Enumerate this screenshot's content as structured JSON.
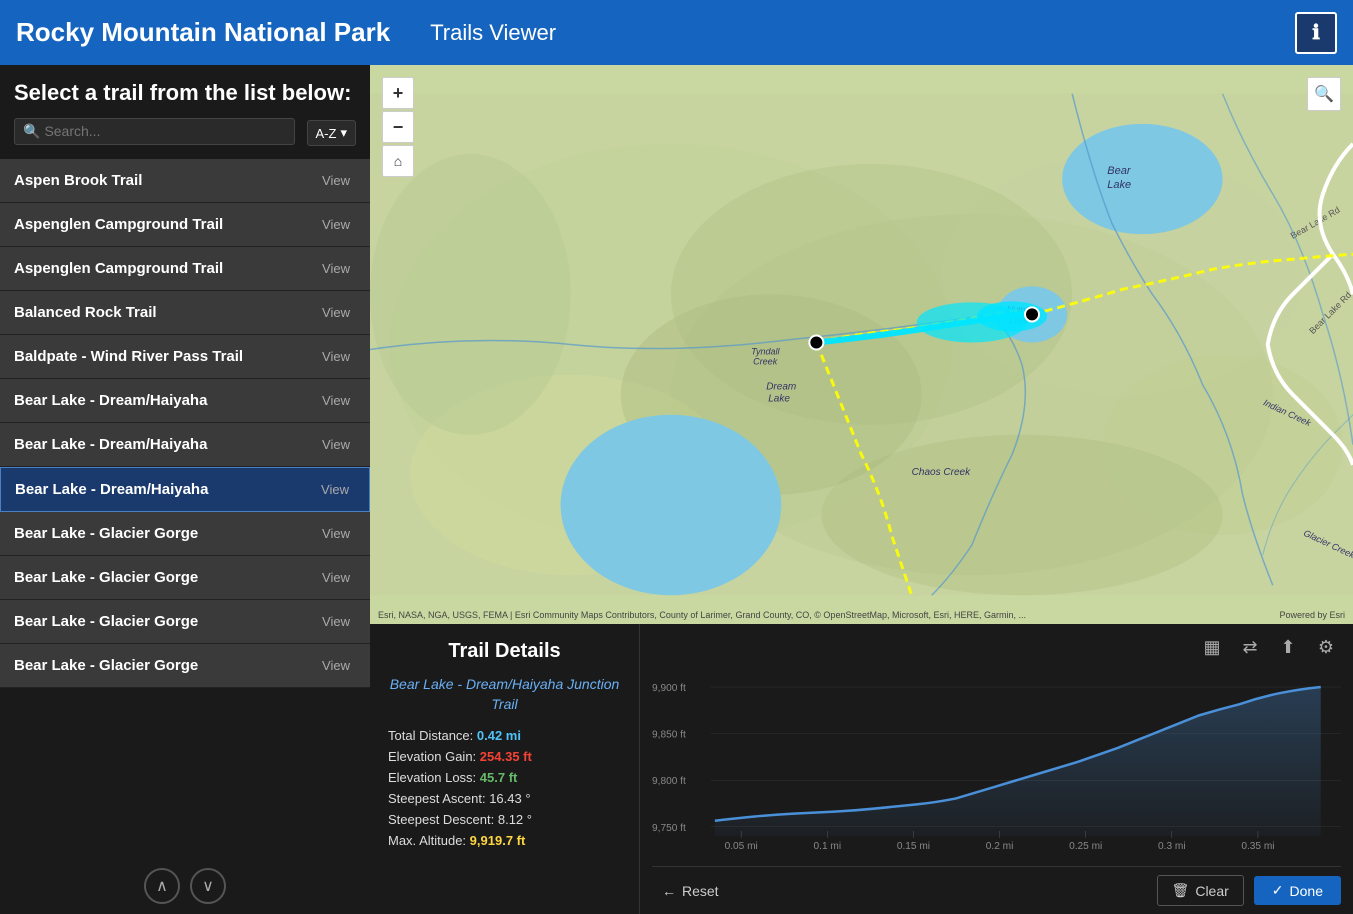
{
  "header": {
    "title": "Rocky Mountain National Park",
    "subtitle": "Trails Viewer",
    "info_label": "ℹ"
  },
  "sidebar": {
    "select_label": "Select a trail from the list below:",
    "search_placeholder": "Search...",
    "sort_label": "A-Z",
    "trails": [
      {
        "name": "Aspen Brook Trail",
        "view_label": "View",
        "selected": false
      },
      {
        "name": "Aspenglen Campground Trail",
        "view_label": "View",
        "selected": false
      },
      {
        "name": "Aspenglen Campground Trail",
        "view_label": "View",
        "selected": false
      },
      {
        "name": "Balanced Rock Trail",
        "view_label": "View",
        "selected": false
      },
      {
        "name": "Baldpate - Wind River Pass Trail",
        "view_label": "View",
        "selected": false
      },
      {
        "name": "Bear Lake - Dream/Haiyaha",
        "view_label": "View",
        "selected": false
      },
      {
        "name": "Bear Lake - Dream/Haiyaha",
        "view_label": "View",
        "selected": false
      },
      {
        "name": "Bear Lake - Dream/Haiyaha",
        "view_label": "View",
        "selected": true
      },
      {
        "name": "Bear Lake - Glacier Gorge",
        "view_label": "View",
        "selected": false
      },
      {
        "name": "Bear Lake - Glacier Gorge",
        "view_label": "View",
        "selected": false
      },
      {
        "name": "Bear Lake - Glacier Gorge",
        "view_label": "View",
        "selected": false
      },
      {
        "name": "Bear Lake - Glacier Gorge",
        "view_label": "View",
        "selected": false
      }
    ],
    "nav_up": "⌃",
    "nav_down": "⌄"
  },
  "map": {
    "attribution": "Esri, NASA, NGA, USGS, FEMA | Esri Community Maps Contributors, County of Larimer, Grand County, CO, © OpenStreetMap, Microsoft, Esri, HERE, Garmin, ...",
    "powered_by": "Powered by Esri",
    "zoom_in": "+",
    "zoom_out": "−",
    "home": "⌂",
    "search": "🔍"
  },
  "trail_details": {
    "title": "Trail Details",
    "trail_name": "Bear Lake - Dream/Haiyaha Junction Trail",
    "stats": {
      "total_distance_label": "Total Distance:",
      "total_distance_val": "0.42 mi",
      "elevation_gain_label": "Elevation Gain:",
      "elevation_gain_val": "254.35 ft",
      "elevation_loss_label": "Elevation Loss:",
      "elevation_loss_val": "45.7 ft",
      "steepest_ascent_label": "Steepest Ascent:",
      "steepest_ascent_val": "16.43 °",
      "steepest_descent_label": "Steepest Descent:",
      "steepest_descent_val": "8.12 °",
      "max_altitude_label": "Max. Altitude:",
      "max_altitude_val": "9,919.7 ft"
    }
  },
  "chart": {
    "y_labels": [
      "9,900 ft",
      "9,850 ft",
      "9,800 ft",
      "9,750 ft"
    ],
    "x_labels": [
      "0.05 mi",
      "0.1 mi",
      "0.15 mi",
      "0.2 mi",
      "0.25 mi",
      "0.3 mi",
      "0.35 mi"
    ],
    "buttons": {
      "bar_chart": "▦",
      "swap": "⇄",
      "share": "⬆",
      "settings": "⚙"
    },
    "reset_label": "Reset",
    "clear_label": "Clear",
    "done_label": "Done"
  },
  "colors": {
    "header_blue": "#1565c0",
    "selected_blue": "#1a3a6e",
    "trail_cyan": "#00e5ff",
    "trail_yellow": "#ffff00",
    "elevation_line": "#4a90d9",
    "val_blue": "#4fc3f7",
    "val_red": "#f44336",
    "val_green": "#66bb6a",
    "val_yellow": "#ffd740"
  }
}
